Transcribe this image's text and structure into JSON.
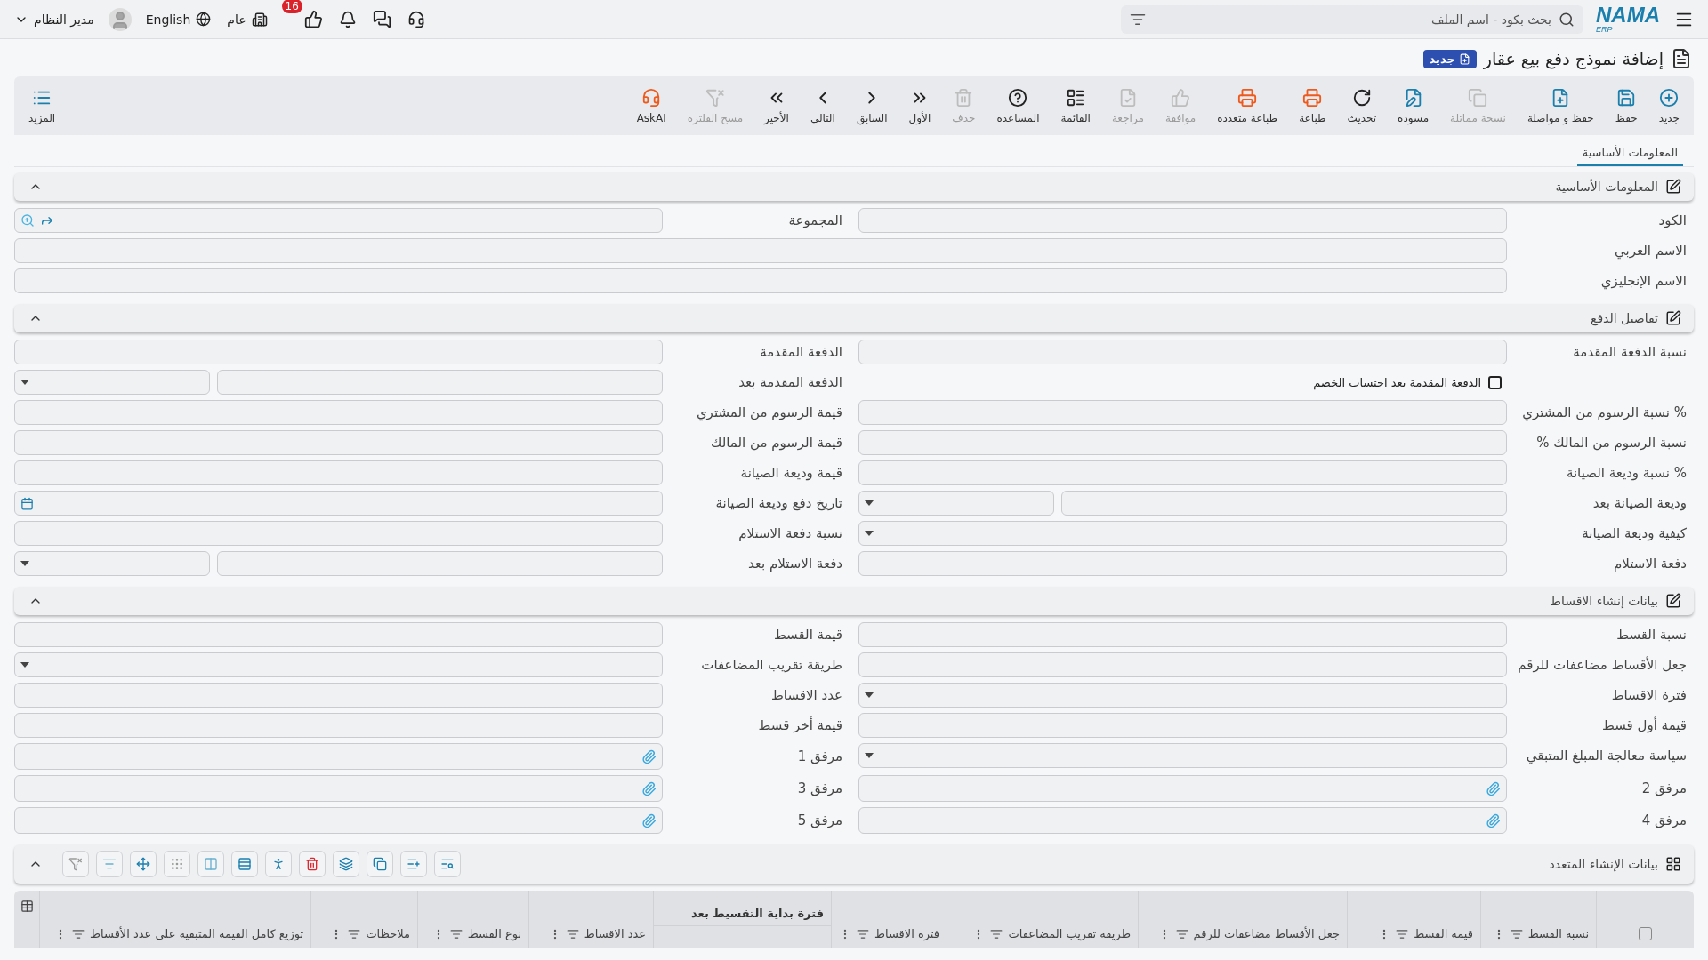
{
  "topbar": {
    "logo": {
      "name": "NAMA",
      "sub": "ERP"
    },
    "search": {
      "placeholder": "بحث بكود - اسم الملف"
    },
    "branch": "عام",
    "notifications": "16",
    "language": "English",
    "user": "مدير النظام"
  },
  "page": {
    "title": "إضافة نموذج دفع بيع عقار",
    "badge": "جديد"
  },
  "toolbar": {
    "actions": [
      {
        "label": "جديد",
        "disabled": false
      },
      {
        "label": "حفظ",
        "disabled": false
      },
      {
        "label": "حفظ و مواصلة",
        "disabled": false
      },
      {
        "label": "نسخة مماثلة",
        "disabled": true
      },
      {
        "label": "مسودة",
        "disabled": false
      },
      {
        "label": "تحديث",
        "disabled": false
      },
      {
        "label": "طباعة",
        "disabled": false
      },
      {
        "label": "طباعة متعددة",
        "disabled": false
      },
      {
        "label": "موافقة",
        "disabled": true
      },
      {
        "label": "مراجعة",
        "disabled": true
      },
      {
        "label": "القائمة",
        "disabled": false
      },
      {
        "label": "المساعدة",
        "disabled": false
      },
      {
        "label": "حذف",
        "disabled": true
      },
      {
        "label": "الأول",
        "disabled": false
      },
      {
        "label": "السابق",
        "disabled": false
      },
      {
        "label": "التالي",
        "disabled": false
      },
      {
        "label": "الأخير",
        "disabled": false
      },
      {
        "label": "مسح الفلترة",
        "disabled": true
      },
      {
        "label": "AskAI",
        "disabled": false
      }
    ],
    "more": "المزيد"
  },
  "tabs": [
    {
      "label": "المعلومات الأساسية",
      "selected": true
    }
  ],
  "sections": [
    {
      "title": "المعلومات الأساسية",
      "expanded": true,
      "rows": [
        [
          {
            "kind": "text",
            "label": "الكود"
          },
          {
            "kind": "lookup",
            "label": "المجموعة"
          }
        ],
        [
          {
            "kind": "text",
            "label": "الاسم العربي"
          }
        ],
        [
          {
            "kind": "text",
            "label": "الاسم الإنجليزي"
          }
        ]
      ]
    },
    {
      "title": "تفاصيل الدفع",
      "expanded": true,
      "rows": [
        [
          {
            "kind": "text",
            "label": "نسبة الدفعة المقدمة"
          },
          {
            "kind": "text",
            "label": "الدفعة المقدمة"
          }
        ],
        [
          {
            "kind": "checkbox",
            "label": "الدفعة المقدمة بعد احتساب الخصم",
            "checked": false
          },
          {
            "kind": "split",
            "label": "الدفعة المقدمة بعد"
          }
        ],
        [
          {
            "kind": "text",
            "label": "% نسبة الرسوم من المشتري"
          },
          {
            "kind": "text",
            "label": "قيمة الرسوم من المشتري"
          }
        ],
        [
          {
            "kind": "text",
            "label": "نسبة الرسوم من المالك %"
          },
          {
            "kind": "text",
            "label": "قيمة الرسوم من المالك"
          }
        ],
        [
          {
            "kind": "text",
            "label": "% نسبة وديعة الصيانة"
          },
          {
            "kind": "text",
            "label": "قيمة وديعة الصيانة"
          }
        ],
        [
          {
            "kind": "split",
            "label": "وديعة الصيانة بعد"
          },
          {
            "kind": "date",
            "label": "تاريخ دفع وديعة الصيانة"
          }
        ],
        [
          {
            "kind": "select",
            "label": "كيفية وديعة الصيانة"
          },
          {
            "kind": "text",
            "label": "نسبة دفعة الاستلام"
          }
        ],
        [
          {
            "kind": "text",
            "label": "دفعة الاستلام"
          },
          {
            "kind": "split",
            "label": "دفعة الاستلام بعد"
          }
        ]
      ]
    },
    {
      "title": "بيانات إنشاء الاقساط",
      "expanded": true,
      "rows": [
        [
          {
            "kind": "text",
            "label": "نسبة القسط"
          },
          {
            "kind": "text",
            "label": "قيمة القسط"
          }
        ],
        [
          {
            "kind": "text",
            "label": "جعل الأقساط مضاعفات للرقم"
          },
          {
            "kind": "select",
            "label": "طريقة تقريب المضاعفات"
          }
        ],
        [
          {
            "kind": "select",
            "label": "فترة الاقساط"
          },
          {
            "kind": "text",
            "label": "عدد الاقساط"
          }
        ],
        [
          {
            "kind": "text",
            "label": "قيمة أول قسط"
          },
          {
            "kind": "text",
            "label": "قيمة أخر قسط"
          }
        ],
        [
          {
            "kind": "select",
            "label": "سياسة معالجة المبلغ المتبقي"
          },
          {
            "kind": "attach",
            "label": "مرفق 1"
          }
        ],
        [
          {
            "kind": "attach",
            "label": "مرفق 2"
          },
          {
            "kind": "attach",
            "label": "مرفق 3"
          }
        ],
        [
          {
            "kind": "attach",
            "label": "مرفق 4"
          },
          {
            "kind": "attach",
            "label": "مرفق 5"
          }
        ]
      ]
    }
  ],
  "grid_section": {
    "title": "بيانات الإنشاء المتعدد",
    "expanded": true,
    "select_all": {
      "checked": false
    },
    "columns": [
      {
        "kind": "plain",
        "label": "نسبة القسط"
      },
      {
        "kind": "plain",
        "label": "قيمة القسط"
      },
      {
        "kind": "plain",
        "label": "جعل الأقساط مضاعفات للرقم"
      },
      {
        "kind": "plain",
        "label": "طريقة تقريب المضاعفات"
      },
      {
        "kind": "plain",
        "label": "فترة الاقساط"
      },
      {
        "kind": "group",
        "label": "فترة بداية التقسيط بعد"
      },
      {
        "kind": "plain",
        "label": "عدد الاقساط"
      },
      {
        "kind": "plain",
        "label": "نوع القسط"
      },
      {
        "kind": "plain",
        "label": "ملاحظات"
      },
      {
        "kind": "plain",
        "label": "توزيع كامل القيمة المتبقية على عدد الأقساط"
      }
    ]
  }
}
